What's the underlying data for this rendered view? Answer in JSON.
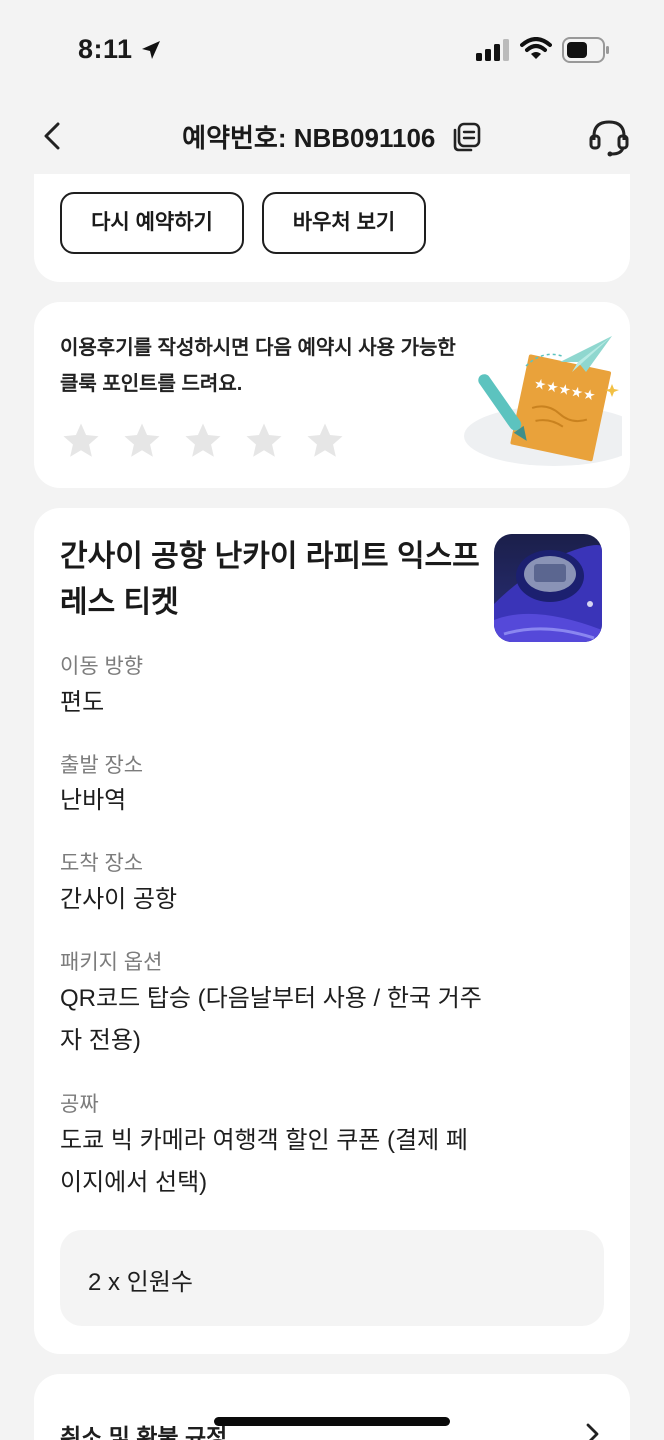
{
  "status_bar": {
    "time": "8:11"
  },
  "header": {
    "title": "예약번호: NBB091106"
  },
  "actions": {
    "rebook_label": "다시 예약하기",
    "voucher_label": "바우처 보기"
  },
  "review": {
    "prompt": "이용후기를 작성하시면 다음 예약시 사용 가능한 클룩 포인트를 드려요.",
    "rating": 0,
    "rating_max": 5,
    "illustration_stars": "★★★★★"
  },
  "product": {
    "title": "간사이 공항 난카이 라피트 익스프레스 티켓",
    "fields": [
      {
        "label": "이동 방향",
        "value": "편도"
      },
      {
        "label": "출발 장소",
        "value": "난바역"
      },
      {
        "label": "도착 장소",
        "value": "간사이 공항"
      },
      {
        "label": "패키지 옵션",
        "value": "QR코드 탑승 (다음날부터 사용 / 한국 거주자 전용)"
      },
      {
        "label": "공짜",
        "value": "도쿄 빅 카메라 여행객 할인 쿠폰 (결제 페이지에서 선택)"
      }
    ],
    "quantity": "2 x 인원수"
  },
  "policy": {
    "label": "취소 및 환불 규정"
  },
  "colors": {
    "background": "#f3f3f3",
    "card": "#ffffff",
    "star_empty": "#e6e6e6",
    "accent_orange": "#e9a23b",
    "accent_teal": "#5cc3bf"
  }
}
